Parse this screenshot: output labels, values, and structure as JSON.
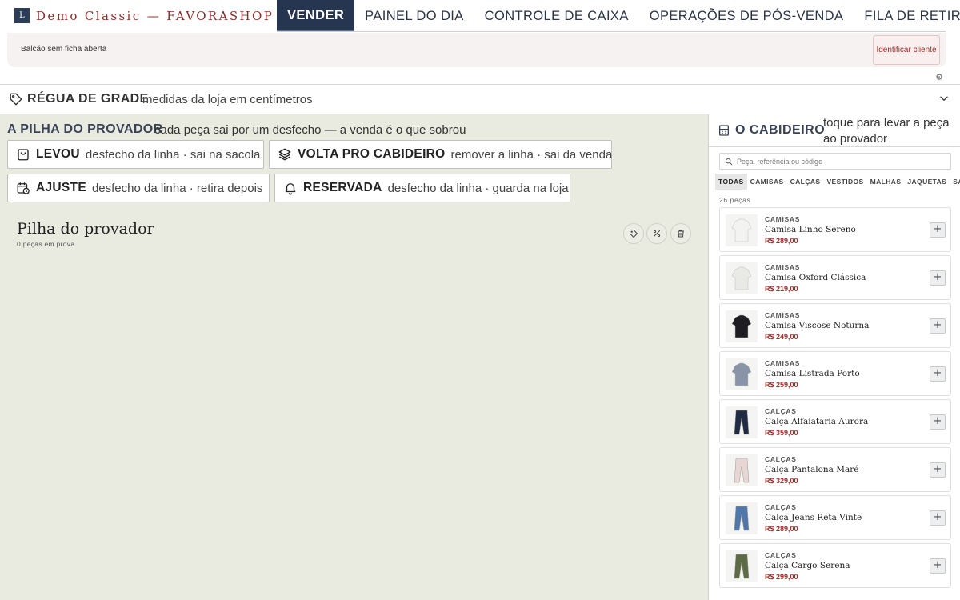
{
  "header": {
    "logo_letter": "L",
    "brand": "Demo Classic — FAVORASHOP",
    "nav": [
      {
        "label": "VENDER",
        "active": true
      },
      {
        "label": "PAINEL DO DIA"
      },
      {
        "label": "CONTROLE DE CAIXA"
      },
      {
        "label": "OPERAÇÕES DE PÓS-VENDA"
      },
      {
        "label": "FILA DE RETIRADA"
      }
    ]
  },
  "customer": {
    "status": "Balcão sem ficha aberta",
    "identify_label": "Identificar cliente"
  },
  "regua": {
    "title": "RÉGUA DE GRADE",
    "subtitle": "medidas da loja em centímetros"
  },
  "pilha": {
    "title": "A PILHA DO PROVADOR",
    "subtitle": "cada peça sai por um desfecho — a venda é o que sobrou",
    "outcomes": [
      {
        "name": "LEVOU",
        "desc": "desfecho da linha · sai na sacola",
        "icon": "bag-icon"
      },
      {
        "name": "VOLTA PRO CABIDEIRO",
        "desc": "remover a linha · sai da venda",
        "icon": "layers-icon"
      },
      {
        "name": "AJUSTE",
        "desc": "desfecho da linha · retira depois",
        "icon": "calendar-clock-icon"
      },
      {
        "name": "RESERVADA",
        "desc": "desfecho da linha · guarda na loja",
        "icon": "bell-icon"
      }
    ],
    "provador_title": "Pilha do provador",
    "provador_count": "0 peças em prova"
  },
  "cabideiro": {
    "title": "O CABIDEIRO",
    "subtitle": "toque para levar a peça ao provador",
    "search_placeholder": "Peça, referência ou código",
    "categories": [
      {
        "label": "TODAS",
        "active": true
      },
      {
        "label": "CAMISAS"
      },
      {
        "label": "CALÇAS"
      },
      {
        "label": "VESTIDOS"
      },
      {
        "label": "MALHAS"
      },
      {
        "label": "JAQUETAS"
      },
      {
        "label": "SAIAS"
      }
    ],
    "count": "26 peças",
    "products": [
      {
        "category": "CAMISAS",
        "name": "Camisa Linho Sereno",
        "price": "R$ 289,00",
        "color": "#f3f3f1"
      },
      {
        "category": "CAMISAS",
        "name": "Camisa Oxford Clássica",
        "price": "R$ 219,00",
        "color": "#e9e9e6"
      },
      {
        "category": "CAMISAS",
        "name": "Camisa Viscose Noturna",
        "price": "R$ 249,00",
        "color": "#1d1d22"
      },
      {
        "category": "CAMISAS",
        "name": "Camisa Listrada Porto",
        "price": "R$ 259,00",
        "color": "#8a94a8"
      },
      {
        "category": "CALÇAS",
        "name": "Calça Alfaiataria Aurora",
        "price": "R$ 359,00",
        "color": "#1f2b45"
      },
      {
        "category": "CALÇAS",
        "name": "Calça Pantalona Maré",
        "price": "R$ 329,00",
        "color": "#e7d6d3"
      },
      {
        "category": "CALÇAS",
        "name": "Calça Jeans Reta Vinte",
        "price": "R$ 289,00",
        "color": "#4f77a8"
      },
      {
        "category": "CALÇAS",
        "name": "Calça Cargo Serena",
        "price": "R$ 299,00",
        "color": "#5c6b45"
      }
    ]
  }
}
